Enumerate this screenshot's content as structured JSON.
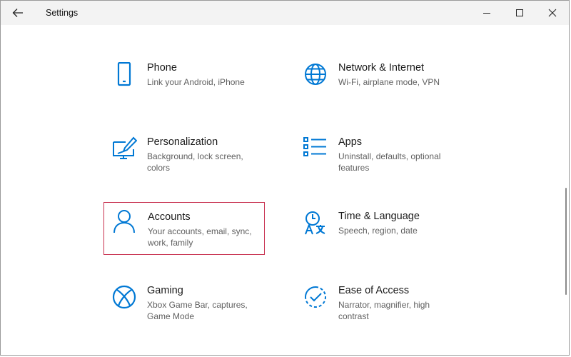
{
  "window": {
    "title": "Settings",
    "back_icon": "back-arrow-icon",
    "controls": [
      "minimize-icon",
      "maximize-icon",
      "close-icon"
    ]
  },
  "accent_color": "#0078d4",
  "selection_border_color": "#c8304f",
  "tiles": [
    {
      "name": "Phone",
      "desc": "Link your Android, iPhone",
      "icon": "phone-icon"
    },
    {
      "name": "Network & Internet",
      "desc": "Wi-Fi, airplane mode, VPN",
      "icon": "globe-icon"
    },
    {
      "name": "Personalization",
      "desc": "Background, lock screen, colors",
      "icon": "personalization-icon"
    },
    {
      "name": "Apps",
      "desc": "Uninstall, defaults, optional features",
      "icon": "apps-list-icon"
    },
    {
      "name": "Accounts",
      "desc": "Your accounts, email, sync, work, family",
      "icon": "person-icon",
      "selected": true
    },
    {
      "name": "Time & Language",
      "desc": "Speech, region, date",
      "icon": "time-language-icon"
    },
    {
      "name": "Gaming",
      "desc": "Xbox Game Bar, captures, Game Mode",
      "icon": "xbox-icon"
    },
    {
      "name": "Ease of Access",
      "desc": "Narrator, magnifier, high contrast",
      "icon": "ease-of-access-icon"
    }
  ]
}
